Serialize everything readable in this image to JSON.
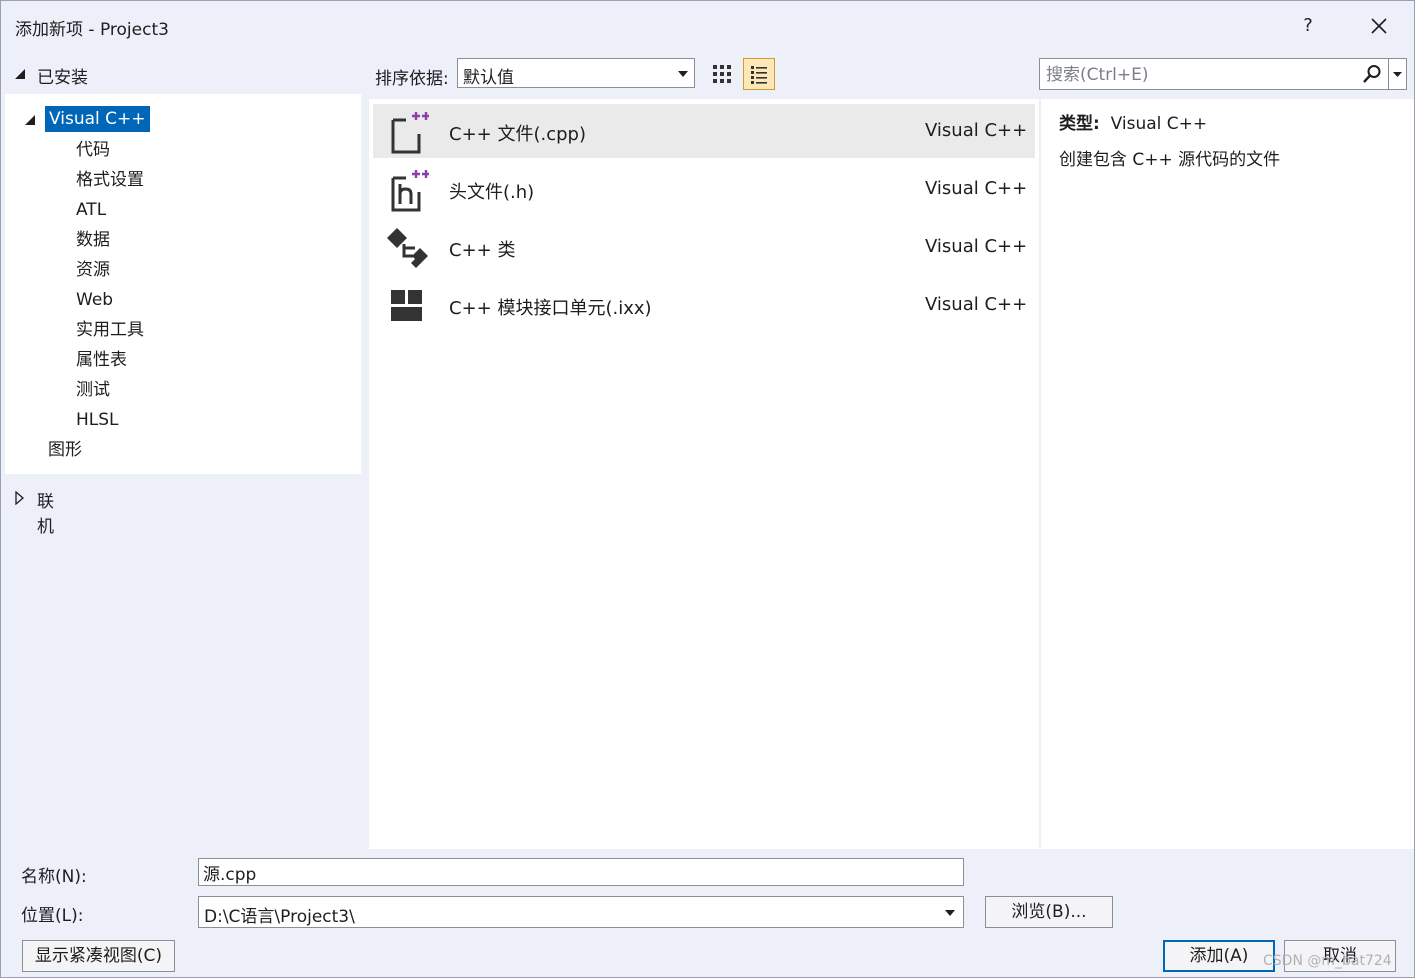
{
  "window": {
    "title": "添加新项 - Project3",
    "help": "?"
  },
  "tree": {
    "installed_label": "已安装",
    "root": "Visual C++",
    "children": [
      "代码",
      "格式设置",
      "ATL",
      "数据",
      "资源",
      "Web",
      "实用工具",
      "属性表",
      "测试",
      "HLSL"
    ],
    "sibling": "图形",
    "online_label": "联机"
  },
  "toolbar": {
    "sort_label": "排序依据:",
    "sort_value": "默认值",
    "search_placeholder": "搜索(Ctrl+E)"
  },
  "templates": [
    {
      "name": "C++ 文件(.cpp)",
      "lang": "Visual C++",
      "icon": "cpp-file-icon"
    },
    {
      "name": "头文件(.h)",
      "lang": "Visual C++",
      "icon": "header-file-icon"
    },
    {
      "name": "C++ 类",
      "lang": "Visual C++",
      "icon": "class-icon"
    },
    {
      "name": "C++ 模块接口单元(.ixx)",
      "lang": "Visual C++",
      "icon": "module-icon"
    }
  ],
  "detail": {
    "type_label": "类型:",
    "type_value": "Visual C++",
    "description": "创建包含 C++ 源代码的文件"
  },
  "form": {
    "name_label": "名称(N):",
    "name_value": "源.cpp",
    "location_label": "位置(L):",
    "location_value": "D:\\C语言\\Project3\\",
    "browse_label": "浏览(B)..."
  },
  "buttons": {
    "compact": "显示紧凑视图(C)",
    "add": "添加(A)",
    "cancel": "取消"
  },
  "watermark": "CSDN @m_bat724",
  "colors": {
    "selection": "#0066b8",
    "accent_purple": "#8b3fa8",
    "active_view": "#fbe7b8"
  }
}
